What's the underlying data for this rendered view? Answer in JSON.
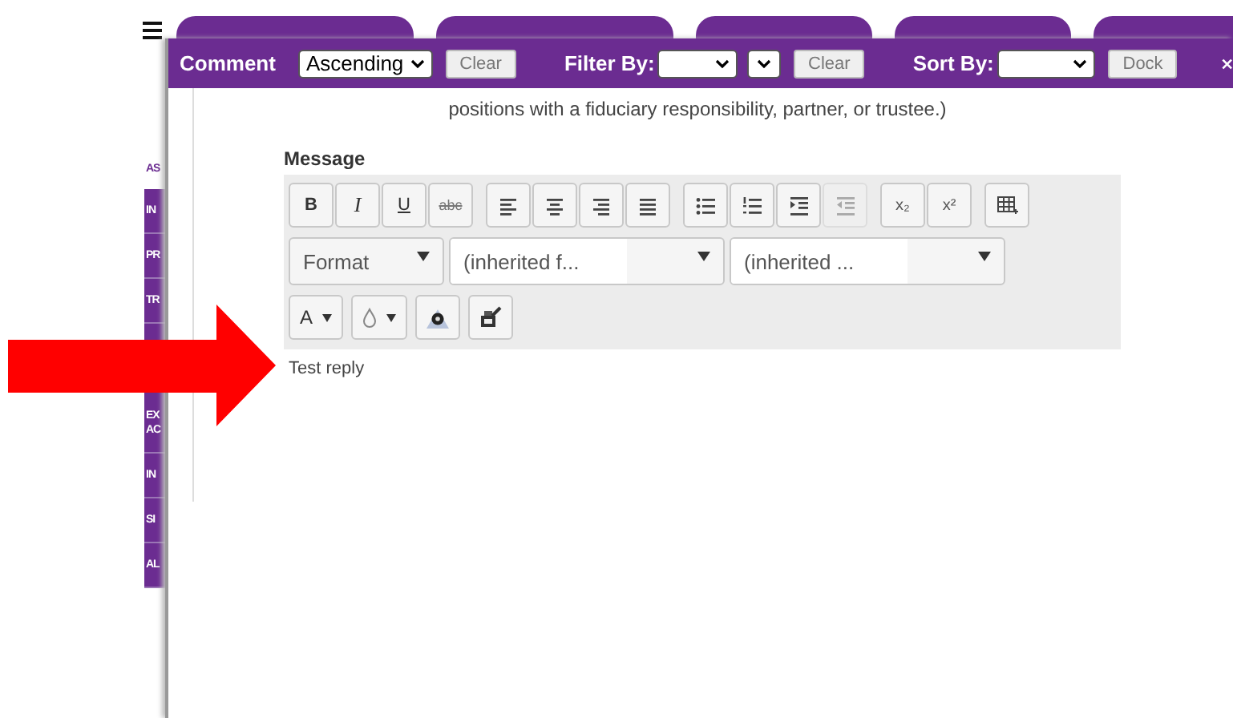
{
  "background_tabs": [
    {
      "kind": "tab"
    },
    {
      "kind": "tab"
    },
    {
      "kind": "tab"
    },
    {
      "kind": "tab"
    },
    {
      "kind": "tab"
    }
  ],
  "sidebar": {
    "items": [
      {
        "label": "AS",
        "selected": true
      },
      {
        "label": "IN",
        "selected": false
      },
      {
        "label": "PR",
        "selected": false
      },
      {
        "label": "TR",
        "selected": false
      },
      {
        "label": "EX AC",
        "selected": false
      },
      {
        "label": "IN",
        "selected": false
      },
      {
        "label": "SI",
        "selected": false
      },
      {
        "label": "AL",
        "selected": false
      }
    ]
  },
  "header": {
    "title": "Comment",
    "order": "Ascending",
    "clear": "Clear",
    "filter_label": "Filter By:",
    "filter_clear": "Clear",
    "sort_label": "Sort By:",
    "dock": "Dock"
  },
  "intro_text": "positions with a fiduciary responsibility, partner, or trustee.)",
  "message_label": "Message",
  "toolbar_groups": [
    [
      {
        "kind": "bold",
        "label": "B",
        "disabled": false
      },
      {
        "kind": "italic",
        "label": "I",
        "disabled": false
      },
      {
        "kind": "underline",
        "label": "U",
        "disabled": false
      },
      {
        "kind": "strike",
        "label": "abc",
        "disabled": false
      }
    ],
    [
      {
        "kind": "align-left",
        "disabled": false
      },
      {
        "kind": "align-center",
        "disabled": false
      },
      {
        "kind": "align-right",
        "disabled": false
      },
      {
        "kind": "justify",
        "disabled": false
      }
    ],
    [
      {
        "kind": "bullet-list",
        "disabled": false
      },
      {
        "kind": "number-list",
        "disabled": false
      },
      {
        "kind": "indent",
        "disabled": false
      },
      {
        "kind": "outdent",
        "disabled": true
      }
    ],
    [
      {
        "kind": "subscript",
        "label": "x₂",
        "disabled": false
      },
      {
        "kind": "superscript",
        "label": "x²",
        "disabled": false
      }
    ],
    [
      {
        "kind": "table",
        "disabled": false
      }
    ]
  ],
  "combos": [
    {
      "kind": "format",
      "value": "Format"
    },
    {
      "kind": "font",
      "value": "(inherited f..."
    },
    {
      "kind": "size",
      "value": "(inherited ..."
    }
  ],
  "extra_buttons": [
    {
      "kind": "text-color",
      "label": "A"
    },
    {
      "kind": "background-color"
    },
    {
      "kind": "spellcheck"
    },
    {
      "kind": "paste"
    }
  ],
  "editor_text": "Test reply"
}
